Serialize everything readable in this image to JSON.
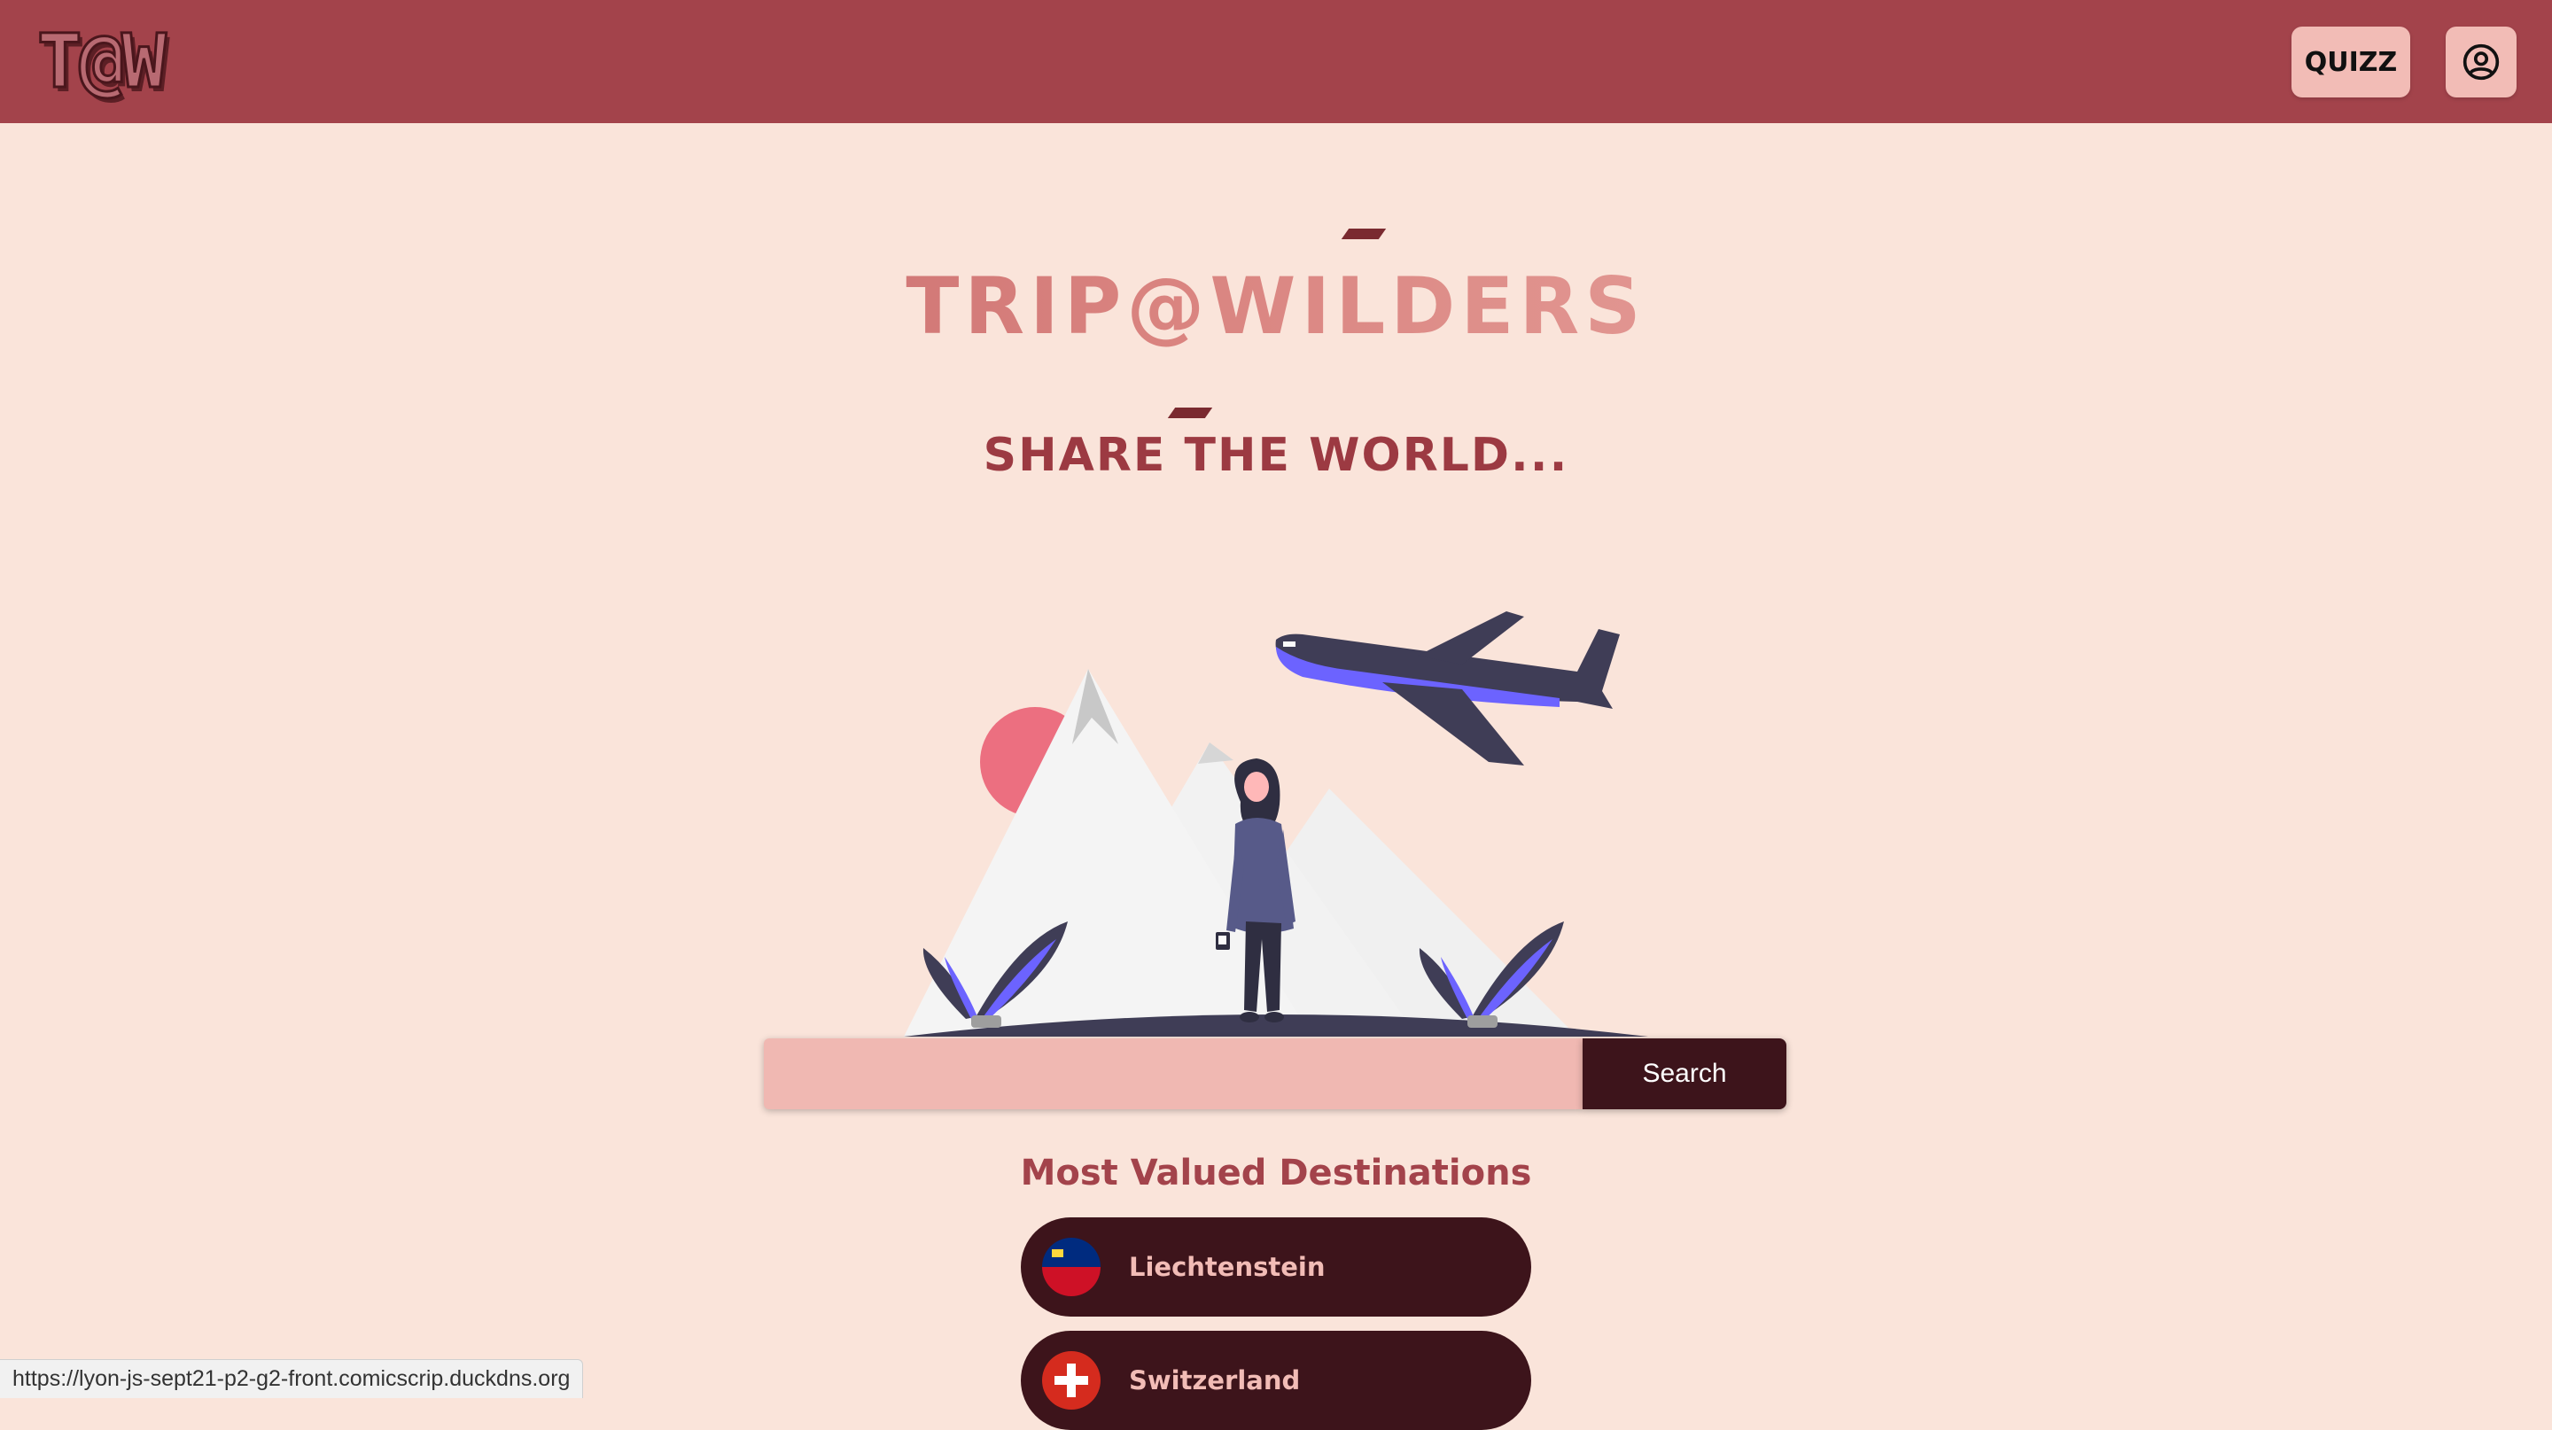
{
  "header": {
    "logo_text": "T@W",
    "quizz_label": "QUIZZ",
    "account_icon": "user-circle-icon"
  },
  "hero": {
    "title": "TRIP@WILDERS",
    "tagline": "SHARE THE WORLD...",
    "illustration": "traveler-mountains-airplane"
  },
  "search": {
    "placeholder": "",
    "value": "",
    "button_label": "Search"
  },
  "destinations": {
    "heading": "Most Valued Destinations",
    "items": [
      {
        "name": "Liechtenstein",
        "flag_icon": "liechtenstein-flag-icon"
      },
      {
        "name": "Switzerland",
        "flag_icon": "switzerland-flag-icon"
      }
    ]
  },
  "status_bar": {
    "url": "https://lyon-js-sept21-p2-g2-front.comicscrip.duckdns.org"
  },
  "colors": {
    "header_bg": "#a3434b",
    "page_bg": "#fae4da",
    "button_bg": "#f2bcb6",
    "dark": "#3d141b",
    "search_input_bg": "#f0b8b2"
  }
}
